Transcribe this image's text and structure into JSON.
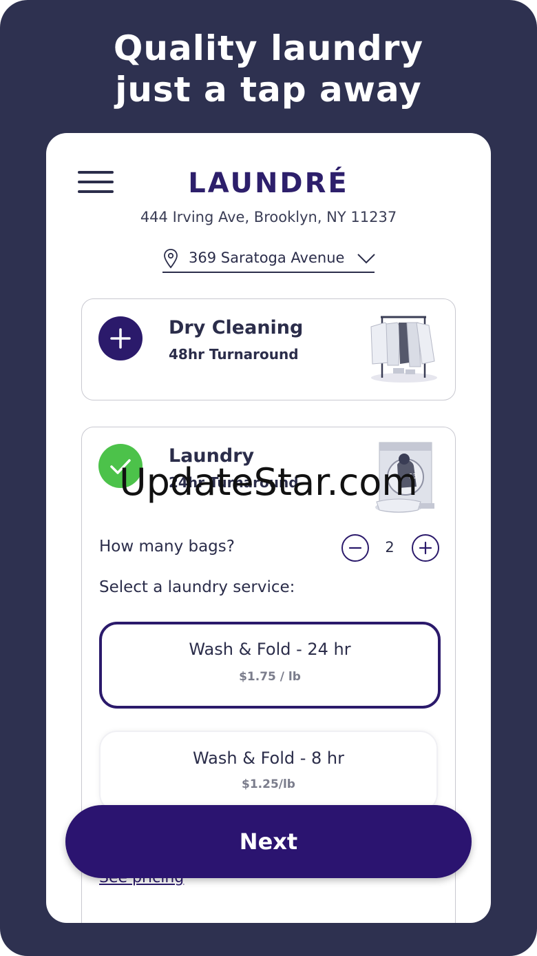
{
  "headline": {
    "line1": "Quality laundry",
    "line2": "just a tap away"
  },
  "header": {
    "menu_icon": "hamburger-menu-icon",
    "brand": "LAUNDRÉ",
    "address": "444 Irving Ave, Brooklyn, NY 11237",
    "location_selector": {
      "value": "369 Saratoga Avenue",
      "icon": "map-pin-icon",
      "dropdown_icon": "chevron-down-icon"
    }
  },
  "services": [
    {
      "title": "Dry Cleaning",
      "subtitle": "48hr Turnaround",
      "state": "add",
      "icon": "plus-icon",
      "illustration": "clothes-rack-illustration"
    },
    {
      "title": "Laundry",
      "subtitle": "24hr Turnaround",
      "state": "selected",
      "icon": "check-icon",
      "illustration": "washing-machine-illustration"
    }
  ],
  "laundry": {
    "bags_label": "How many bags?",
    "bags_count": "2",
    "service_label": "Select a laundry service:",
    "options": [
      {
        "name": "Wash & Fold - 24 hr",
        "price": "$1.75 / lb",
        "selected": true
      },
      {
        "name": "Wash & Fold - 8 hr",
        "price": "$1.25/lb",
        "selected": false
      }
    ],
    "see_pricing": "See pricing"
  },
  "next_button": "Next",
  "watermark": "UpdateStar.com",
  "colors": {
    "background": "#2e3150",
    "primary": "#2b1470",
    "success": "#4cc24a",
    "text": "#2b2d4a"
  }
}
